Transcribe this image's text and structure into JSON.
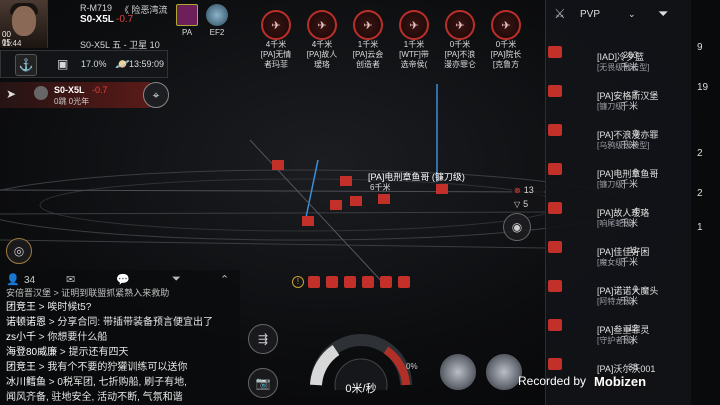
{
  "character": {
    "corp_line": "R-M719",
    "location": "《 险恶湾流",
    "ship_name": "S0-X5L",
    "security": "-0.7",
    "time": "11:44",
    "system_info": "S0-X5L 五 - 卫星 10",
    "small_num_1": "00",
    "small_num_2": "05"
  },
  "status_bar": {
    "percent": "17.0%",
    "clock": "13:59:09"
  },
  "route": {
    "system": "S0-X5L",
    "jumps": "0跳 0光年",
    "sec": "-0.7"
  },
  "alliance": {
    "left_label": "PA",
    "right_label": "EF2"
  },
  "targets": [
    {
      "dist": "4千米",
      "name": "[PA]无情",
      "sub": "者玛菲"
    },
    {
      "dist": "4千米",
      "name": "[PA]故人",
      "sub": "瑷珞"
    },
    {
      "dist": "1千米",
      "name": "[PA]云会",
      "sub": "创造者"
    },
    {
      "dist": "1千米",
      "name": "[WTF]带",
      "sub": "选帝侯("
    },
    {
      "dist": "0千米",
      "name": "[PA]不浪",
      "sub": "漫亦罪仑"
    },
    {
      "dist": "0千米",
      "name": "[PA]院长",
      "sub": "[克鲁方"
    }
  ],
  "space_labels": {
    "target_name": "[PA]电刑章鱼哥 (镰刀级)",
    "target_dist": "6千米",
    "count_red": "13",
    "count_white": "5"
  },
  "overview": {
    "tab": "PVP",
    "rows": [
      {
        "dist": "293",
        "unit": "千米",
        "name": "[IAD]冷夕蓝",
        "corp": "[无畏级截击型]"
      },
      {
        "dist": "7",
        "unit": "千米",
        "name": "[PA]安格斯汉堡",
        "corp": "[镰刀级]"
      },
      {
        "dist": "0",
        "unit": "千米",
        "name": "[PA]不浪漫亦罪",
        "corp": "[乌鸦级级袭型]"
      },
      {
        "dist": "6",
        "unit": "千米",
        "name": "[PA]电刑章鱼哥",
        "corp": "[镰刀级]"
      },
      {
        "dist": "4",
        "unit": "千米",
        "name": "[PA]故人瑷珞",
        "corp": "[响尾蛇级]"
      },
      {
        "dist": "11",
        "unit": "千米",
        "name": "[PA]佳佳好困",
        "corp": "[魔女级]"
      },
      {
        "dist": "0",
        "unit": "千米",
        "name": "[PA]诺诺大魔头",
        "corp": "[阿特龙级]"
      },
      {
        "dist": "12",
        "unit": "千米",
        "name": "[PA]叁重罪灵",
        "corp": "[守护者级]"
      },
      {
        "dist": "38",
        "unit": "千米",
        "name": "[PA]沃尔沃001",
        "corp": ""
      }
    ]
  },
  "side_counts": [
    "9",
    "19",
    "2",
    "2",
    "1"
  ],
  "chat": {
    "unread": "34",
    "lines": [
      {
        "name": "团竞王",
        "text": "唉时候t5?"
      },
      {
        "name": "诺顿诺恩",
        "text": "分享合同: 带插带装备预言便宜出了"
      },
      {
        "name": "zs小千",
        "text": "你想要什么船"
      },
      {
        "name": "海登80威廉",
        "text": "提示还有四天"
      },
      {
        "name": "团竞王",
        "text": "我有个不要的狞獾训练可以送你"
      },
      {
        "name": "冰川鳕鱼",
        "text": "0税军团, 七折购船, 刷子有地,"
      },
      {
        "name": "",
        "text": "闻风齐备, 驻地安全, 活动不断, 气氛和谐"
      }
    ],
    "top_line": "安倍晋汉堡 > 证明到联盟抓紧熟入来救助"
  },
  "hud": {
    "speed": "0米/秒",
    "percent": "0%"
  },
  "watermark": {
    "prefix": "Recorded by",
    "brand": "Mobizen"
  },
  "colors": {
    "hostile": "#c3302a",
    "accent_blue": "#3b8fd9"
  }
}
